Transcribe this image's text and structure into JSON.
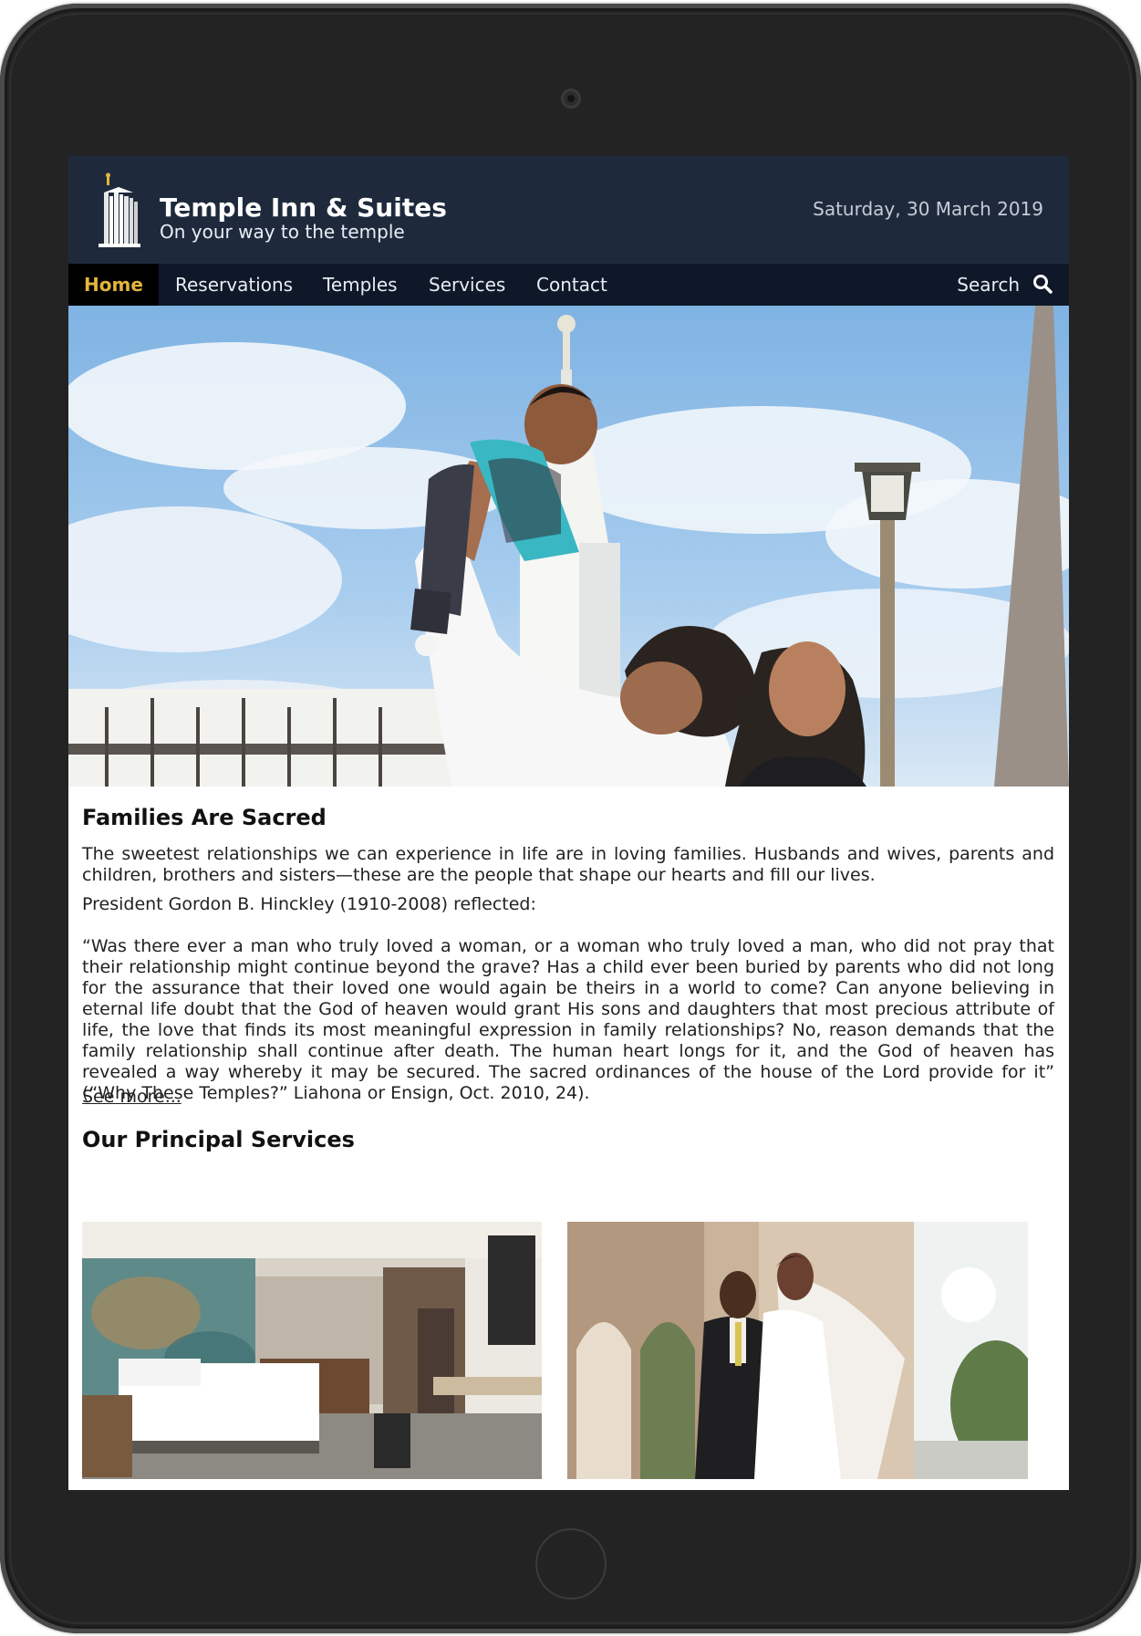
{
  "header": {
    "title": "Temple Inn & Suites",
    "subtitle": "On your way to the temple",
    "date": "Saturday, 30 March 2019"
  },
  "nav": {
    "items": [
      {
        "label": "Home",
        "active": true
      },
      {
        "label": "Reservations",
        "active": false
      },
      {
        "label": "Temples",
        "active": false
      },
      {
        "label": "Services",
        "active": false
      },
      {
        "label": "Contact",
        "active": false
      }
    ],
    "search_label": "Search"
  },
  "main": {
    "families_heading": "Families Are Sacred",
    "paragraph_1": "The sweetest relationships we can experience in life are in loving families. Husbands and wives, parents and children, brothers and sisters—these are the people that shape our hearts and fill our lives.",
    "paragraph_2": "President Gordon B. Hinckley (1910-2008) reflected:",
    "quote": "“Was there ever a man who truly loved a woman, or a woman who truly loved a man, who did not pray that their relationship might continue beyond the grave? Has a child ever been buried by parents who did not long for the assurance that their loved one would again be theirs in a world to come? Can anyone believing in eternal life doubt that the God of heaven would grant His sons and daughters that most precious attribute of life, the love that finds its most meaningful expression in family relationships? No, reason demands that the family relationship shall continue after death. The human heart longs for it, and the God of heaven has revealed a way whereby it may be secured. The sacred ordinances of the house of the Lord provide for it” (“Why These Temples?” Liahona or Ensign, Oct. 2010, 24).",
    "see_more": "See more...",
    "services_heading": "Our Principal Services"
  },
  "colors": {
    "header_bg": "#1e2a3c",
    "nav_bg": "#0e1829",
    "active_nav_text": "#e3b53c"
  },
  "icons": {
    "search": "search-icon",
    "logo": "temple-logo-icon"
  }
}
